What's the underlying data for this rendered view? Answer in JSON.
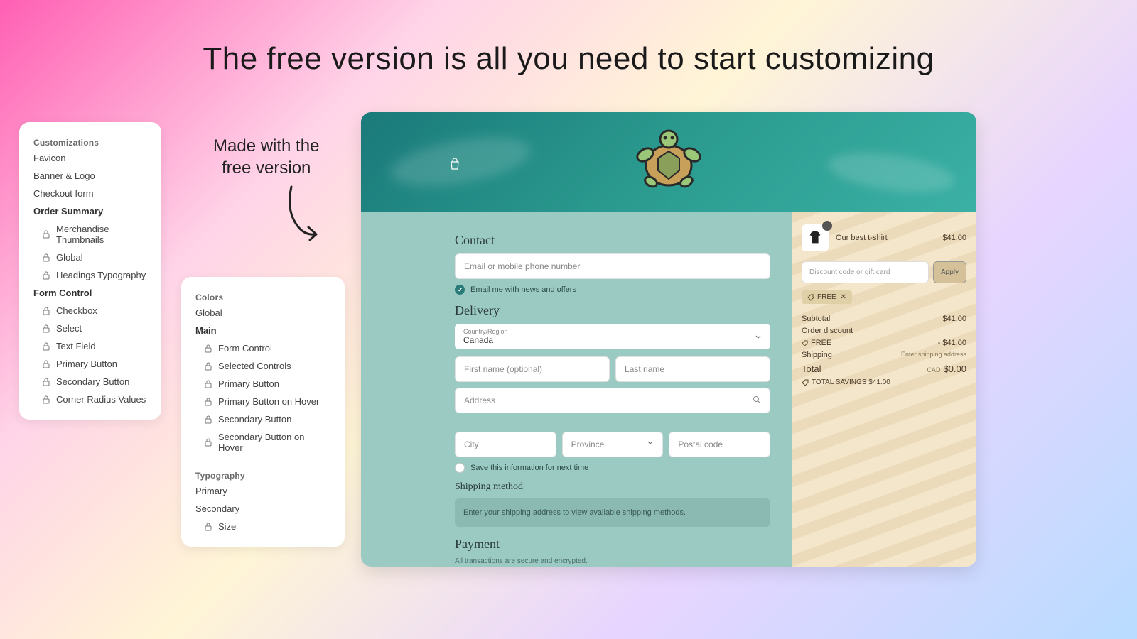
{
  "headline": "The free version is all you need to start customizing",
  "annotation": {
    "line1": "Made with the",
    "line2": "free version"
  },
  "panelA": {
    "header": "Customizations",
    "plain": [
      "Favicon",
      "Banner & Logo",
      "Checkout form"
    ],
    "section1": "Order Summary",
    "items1": [
      "Merchandise Thumbnails",
      "Global",
      "Headings Typography"
    ],
    "section2": "Form Control",
    "items2": [
      "Checkbox",
      "Select",
      "Text Field",
      "Primary Button",
      "Secondary Button",
      "Corner Radius Values"
    ]
  },
  "panelB": {
    "header": "Colors",
    "plain1": [
      "Global"
    ],
    "section1": "Main",
    "items1": [
      "Form Control",
      "Selected Controls",
      "Primary Button",
      "Primary Button on Hover",
      "Secondary Button",
      "Secondary Button on Hover"
    ],
    "header2": "Typography",
    "plain2": [
      "Primary",
      "Secondary"
    ],
    "items2": [
      "Size"
    ]
  },
  "checkout": {
    "contact": {
      "heading": "Contact",
      "email_ph": "Email or mobile phone number",
      "news_label": "Email me with news and offers"
    },
    "delivery": {
      "heading": "Delivery",
      "country_label": "Country/Region",
      "country_value": "Canada",
      "first_ph": "First name (optional)",
      "last_ph": "Last name",
      "address_ph": "Address",
      "city_ph": "City",
      "province_ph": "Province",
      "postal_ph": "Postal code",
      "save_label": "Save this information for next time"
    },
    "shipping": {
      "heading": "Shipping method",
      "info": "Enter your shipping address to view available shipping methods."
    },
    "payment": {
      "heading": "Payment",
      "note": "All transactions are secure and encrypted."
    },
    "summary": {
      "product": "Our best t-shirt",
      "price": "$41.00",
      "discount_ph": "Discount code or gift card",
      "apply": "Apply",
      "badge": "FREE",
      "rows": {
        "subtotal_l": "Subtotal",
        "subtotal_v": "$41.00",
        "discount_l": "Order discount",
        "free_l": "FREE",
        "free_v": "- $41.00",
        "shipping_l": "Shipping",
        "shipping_v": "Enter shipping address",
        "total_l": "Total",
        "total_cur": "CAD",
        "total_v": "$0.00",
        "savings": "TOTAL SAVINGS  $41.00"
      }
    }
  }
}
